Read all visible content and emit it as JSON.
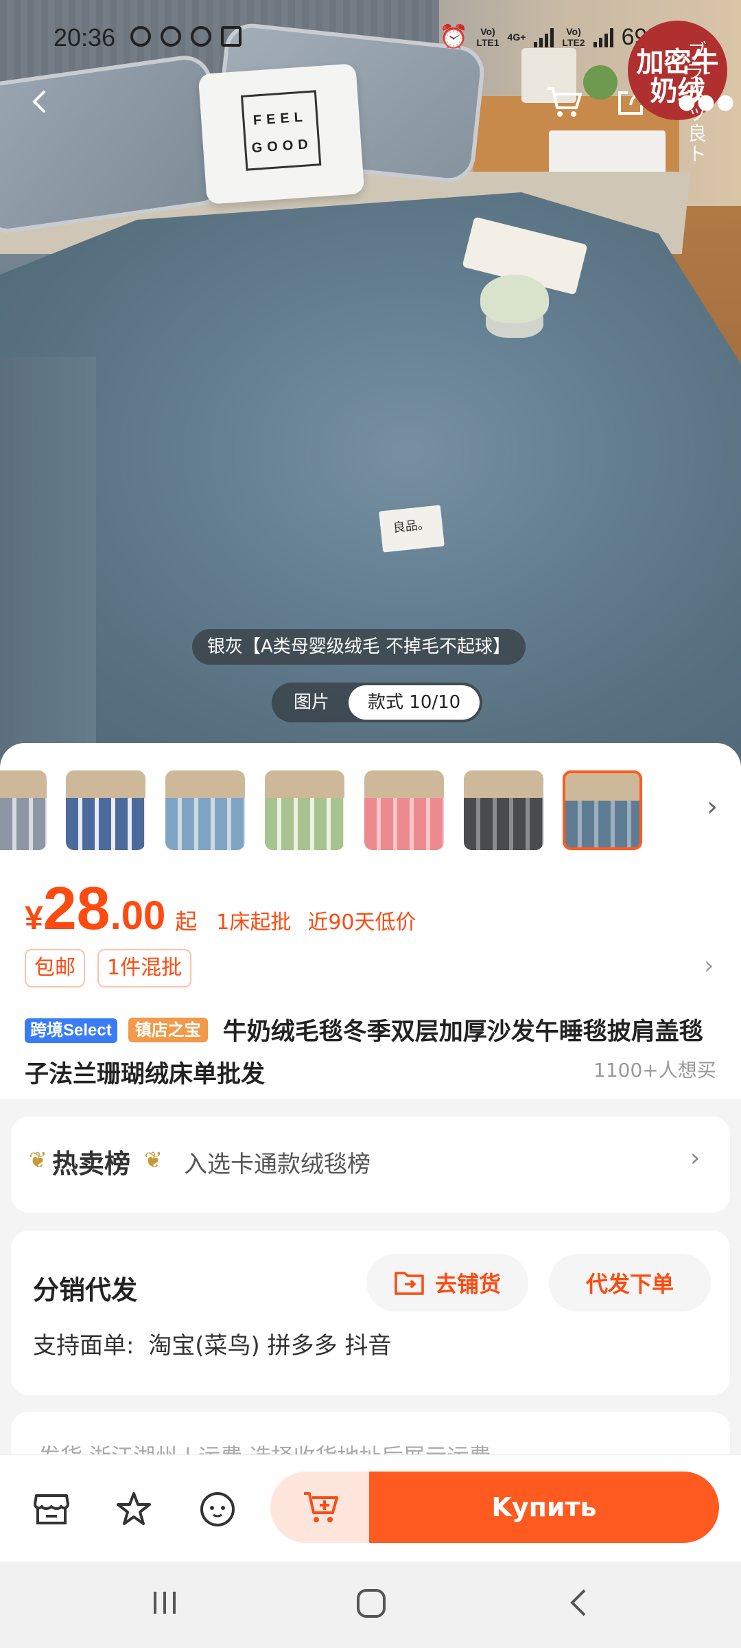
{
  "status_bar": {
    "time": "20:36",
    "battery": "69%",
    "sim1": "LTE1",
    "sim2": "LTE2",
    "net": "4G+"
  },
  "hero": {
    "corner_badge": "加密牛奶绒",
    "corner_vertical": "ブラ-タッ良ト",
    "cushion_line1": "FEEL",
    "cushion_line2": "GOOD",
    "blanket_tag": "良品。",
    "variant_caption": "银灰【A类母婴级绒毛 不掉毛不起球】",
    "media_tabs": [
      "图片",
      "款式 10/10"
    ]
  },
  "thumbnails": [
    {
      "color": "#8e96a6",
      "accent": "#d7dbe2"
    },
    {
      "color": "#4d6a9c",
      "accent": "#e8ecf3"
    },
    {
      "color": "#7fa4c4",
      "accent": "#cfd9e3"
    },
    {
      "color": "#a7c38f",
      "accent": "#eef0e4"
    },
    {
      "color": "#ec8a8f",
      "accent": "#f8c6c6"
    },
    {
      "color": "#4a4b4f",
      "accent": "#8b8c90"
    },
    {
      "color": "#5f7c92",
      "accent": "#9db0bf"
    }
  ],
  "price": {
    "symbol": "¥",
    "integer": "28",
    "decimal": ".00",
    "suffix": "起",
    "min_order": "1床起批",
    "low_price": "近90天低价"
  },
  "chips": [
    "包邮",
    "1件混批"
  ],
  "product": {
    "tag_cross_border": "跨境Select",
    "tag_store": "镇店之宝",
    "title": "牛奶绒毛毯冬季双层加厚沙发午睡毯披肩盖毯子法兰珊瑚绒床单批发",
    "wants": "1100+人想买"
  },
  "hot_rank": {
    "label": "热卖榜",
    "desc": "入选卡通款绒毯榜"
  },
  "distribution": {
    "label": "分销代发",
    "btn_shop": "去铺货",
    "btn_order": "代发下单",
    "support_label": "支持面单:",
    "platforms": "淘宝(菜鸟) 拼多多 抖音"
  },
  "shipping_partial": "发货 浙江湖州 | 运费 选择收货地址后展示运费",
  "bottom": {
    "buy_label": "Kупить"
  },
  "colors": {
    "accent": "#ff5a1f",
    "price": "#ff4a10"
  }
}
